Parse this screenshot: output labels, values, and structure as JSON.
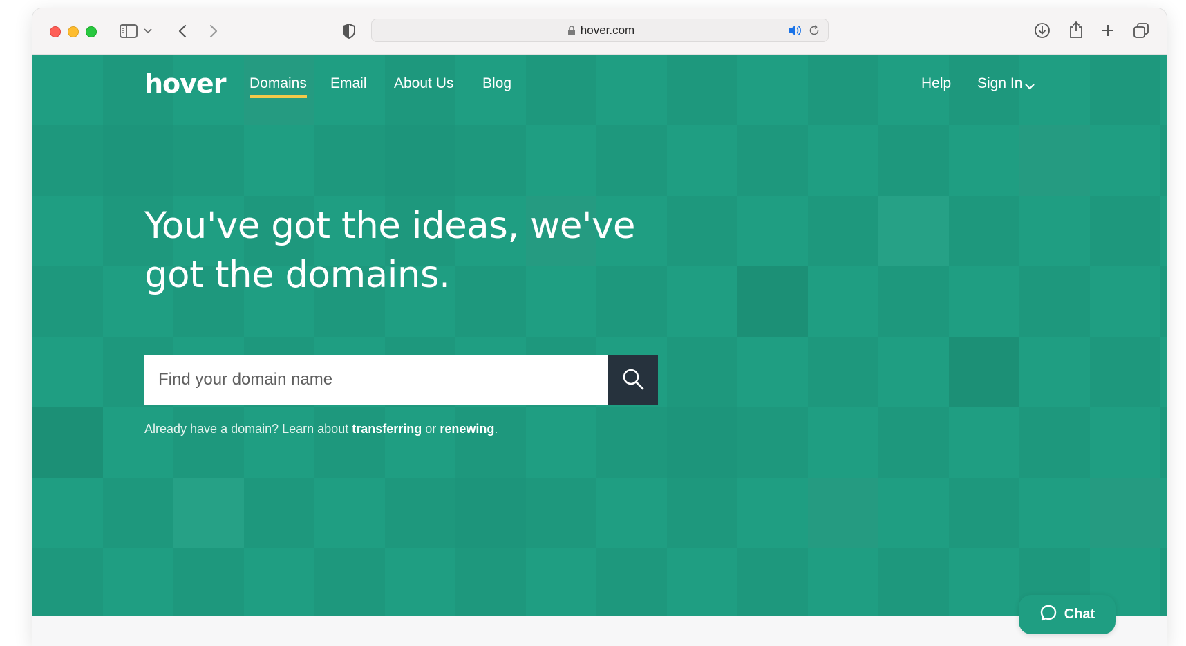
{
  "browser": {
    "url": "hover.com",
    "icons": [
      "sidebar-icon",
      "chevron-down-icon",
      "back-icon",
      "forward-icon",
      "shield-icon",
      "lock-icon",
      "speaker-icon",
      "reload-icon",
      "download-icon",
      "share-icon",
      "new-tab-icon",
      "tabs-overview-icon"
    ]
  },
  "site": {
    "logo": "hover",
    "nav": {
      "domains": "Domains",
      "email": "Email",
      "about": "About Us",
      "blog": "Blog",
      "help": "Help",
      "signin": "Sign In"
    },
    "headline": "You've got the ideas, we've got the domains.",
    "search": {
      "placeholder": "Find your domain name",
      "value": ""
    },
    "hint": {
      "prefix": "Already have a domain? Learn about",
      "transfer_link": "transferring",
      "middle": "or",
      "renew_link": "renewing",
      "suffix": "."
    },
    "chat": "Chat"
  },
  "colors": {
    "brand_green": "#1f9e82",
    "active_underline": "#f3c94a",
    "search_button": "#26323d"
  }
}
